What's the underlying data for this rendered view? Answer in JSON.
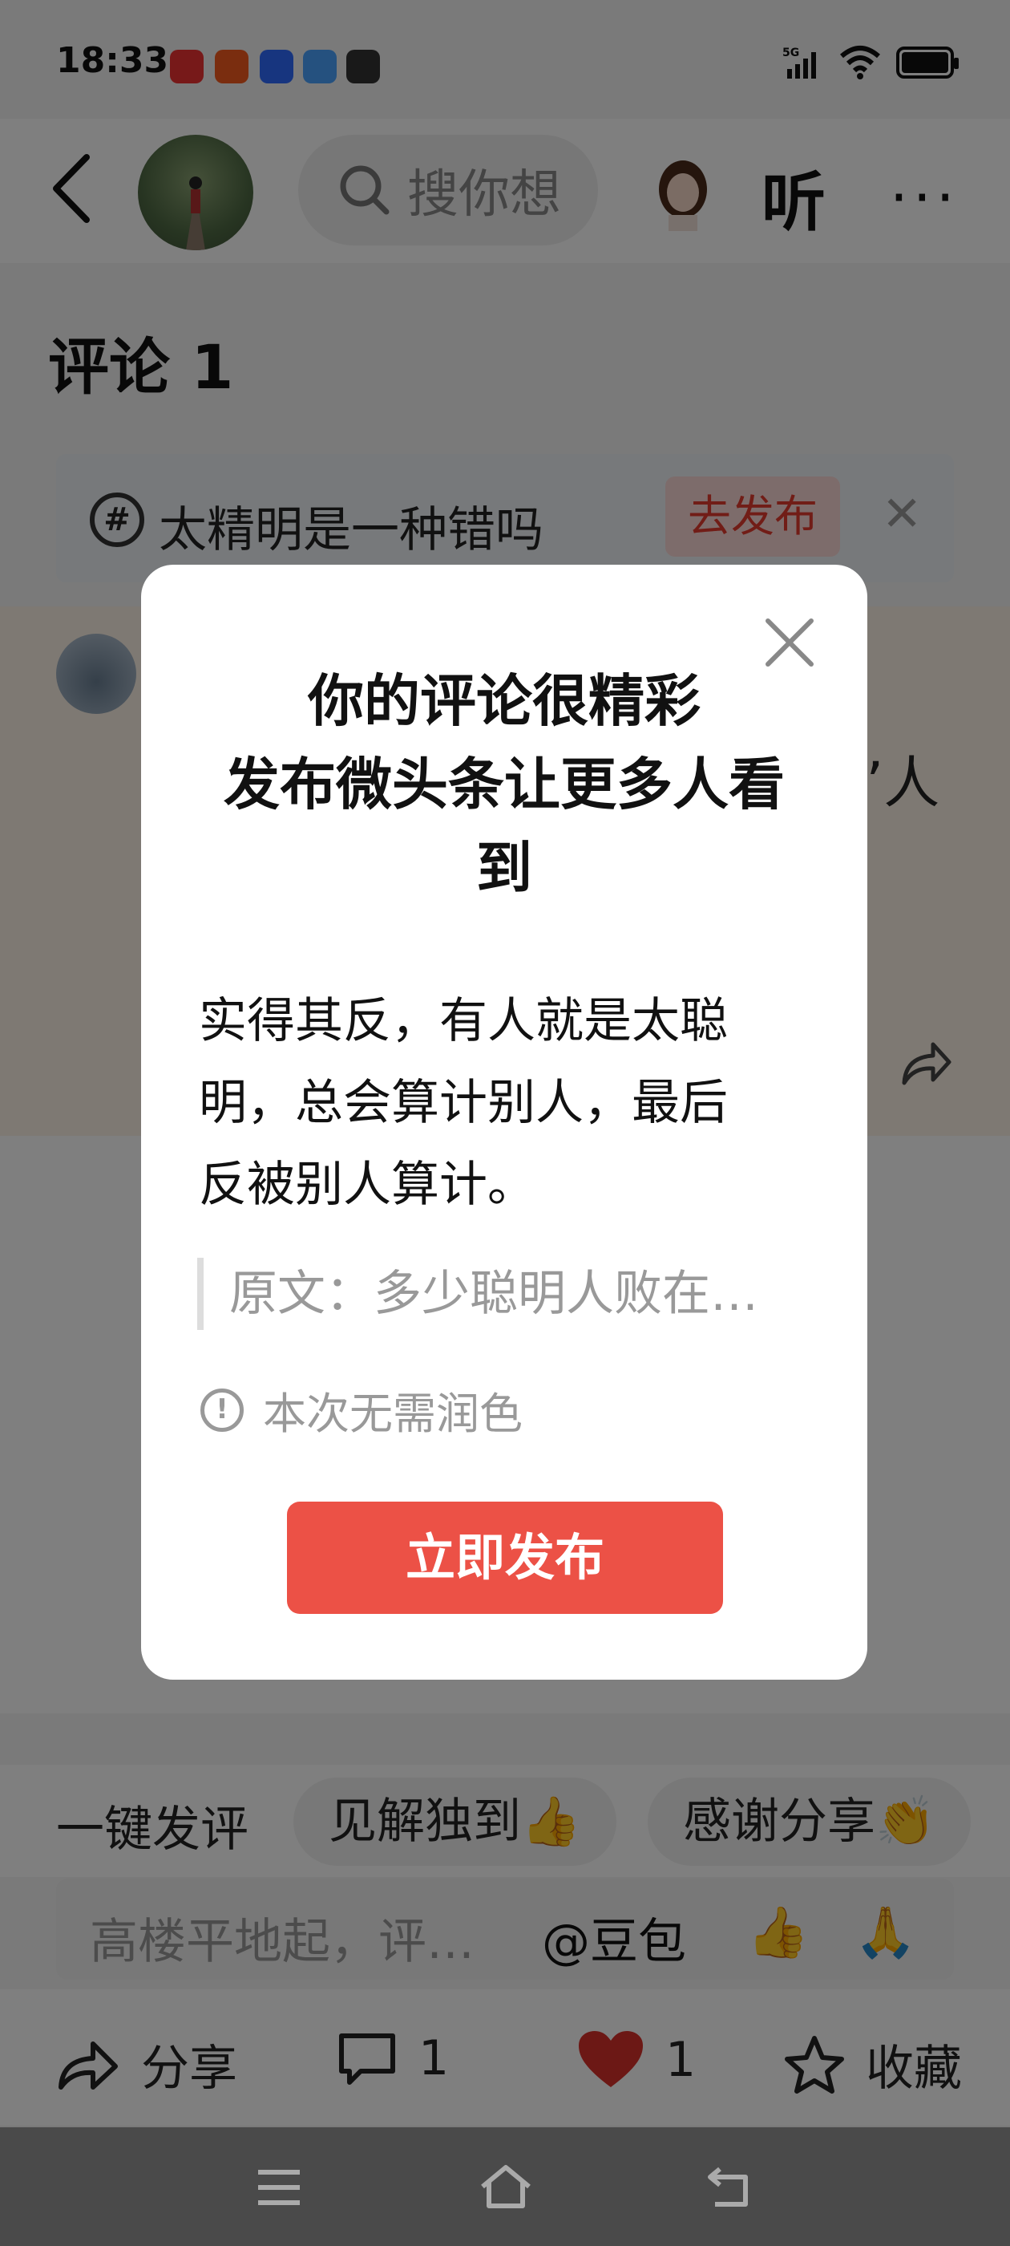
{
  "status_bar": {
    "time": "18:33",
    "network": "5G",
    "battery_level": 1.0
  },
  "header": {
    "search_placeholder": "搜你想",
    "listen_label": "听",
    "more_label": "···"
  },
  "comments": {
    "title": "评论 1"
  },
  "topic": {
    "text": "太精明是一种错吗",
    "publish_label": "去发布",
    "close_label": "✕"
  },
  "comment": {
    "tail_text": "’人"
  },
  "quick_reply": {
    "label": "一键发评",
    "chips": [
      "见解独到👍",
      "感谢分享👏"
    ]
  },
  "reply_input": {
    "placeholder": "高楼平地起，评…",
    "doubao_label": "@豆包"
  },
  "actions": {
    "share_label": "分享",
    "comment_count": "1",
    "like_count": "1",
    "favorite_label": "收藏"
  },
  "dialog": {
    "title_line1": "你的评论很精彩",
    "title_line2": "发布微头条让更多人看",
    "title_line3": "到",
    "body_line1": "实得其反，有人就是太聪",
    "body_line2": "明，总会算计别人，最后",
    "body_line3": "反被别人算计。",
    "quote": "原文：多少聪明人败在…",
    "note": "本次无需润色",
    "publish_button": "立即发布"
  },
  "colors": {
    "accent": "#ec5146",
    "like": "#d9312b"
  }
}
